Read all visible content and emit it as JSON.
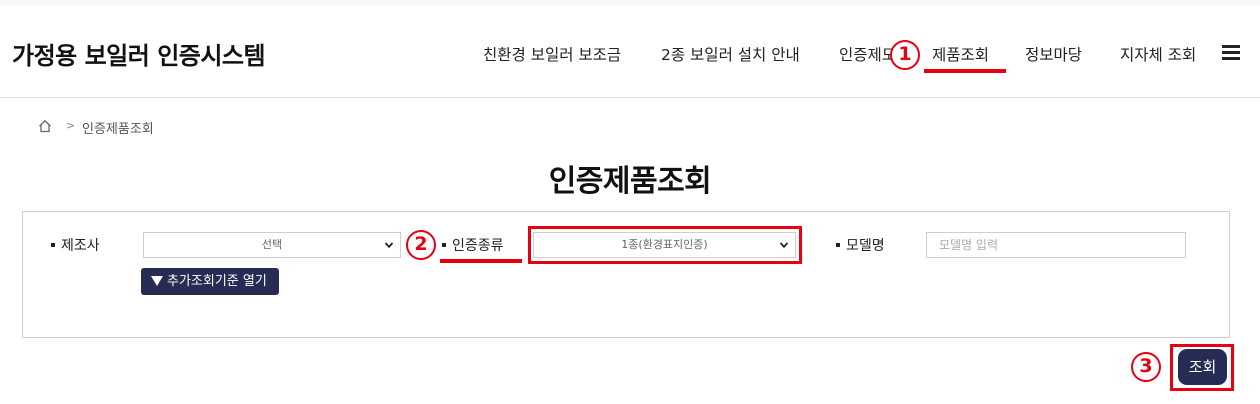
{
  "header": {
    "brand": "가정용 보일러 인증시스템",
    "nav": [
      {
        "label": "친환경 보일러 보조금"
      },
      {
        "label": "2종 보일러 설치 안내"
      },
      {
        "label": "인증제도"
      },
      {
        "label": "제품조회"
      },
      {
        "label": "정보마당"
      },
      {
        "label": "지자체 조회"
      }
    ],
    "menu_icon": "hamburger-menu-icon"
  },
  "markers": [
    "1",
    "2",
    "3"
  ],
  "breadcrumb": {
    "home_icon": "home-icon",
    "separator": ">",
    "current": "인증제품조회"
  },
  "page_title": "인증제품조회",
  "search_form": {
    "manufacturer": {
      "label": "제조사",
      "value": "선택"
    },
    "cert_type": {
      "label": "인증종류",
      "value": "1종(환경표지인증)"
    },
    "model_name": {
      "label": "모델명",
      "placeholder": "모델명 입력",
      "value": ""
    },
    "more_criteria_button": "추가조회기준 열기",
    "search_button": "조회"
  },
  "colors": {
    "accent_navy": "#262c53",
    "highlight_red": "#e60012"
  }
}
